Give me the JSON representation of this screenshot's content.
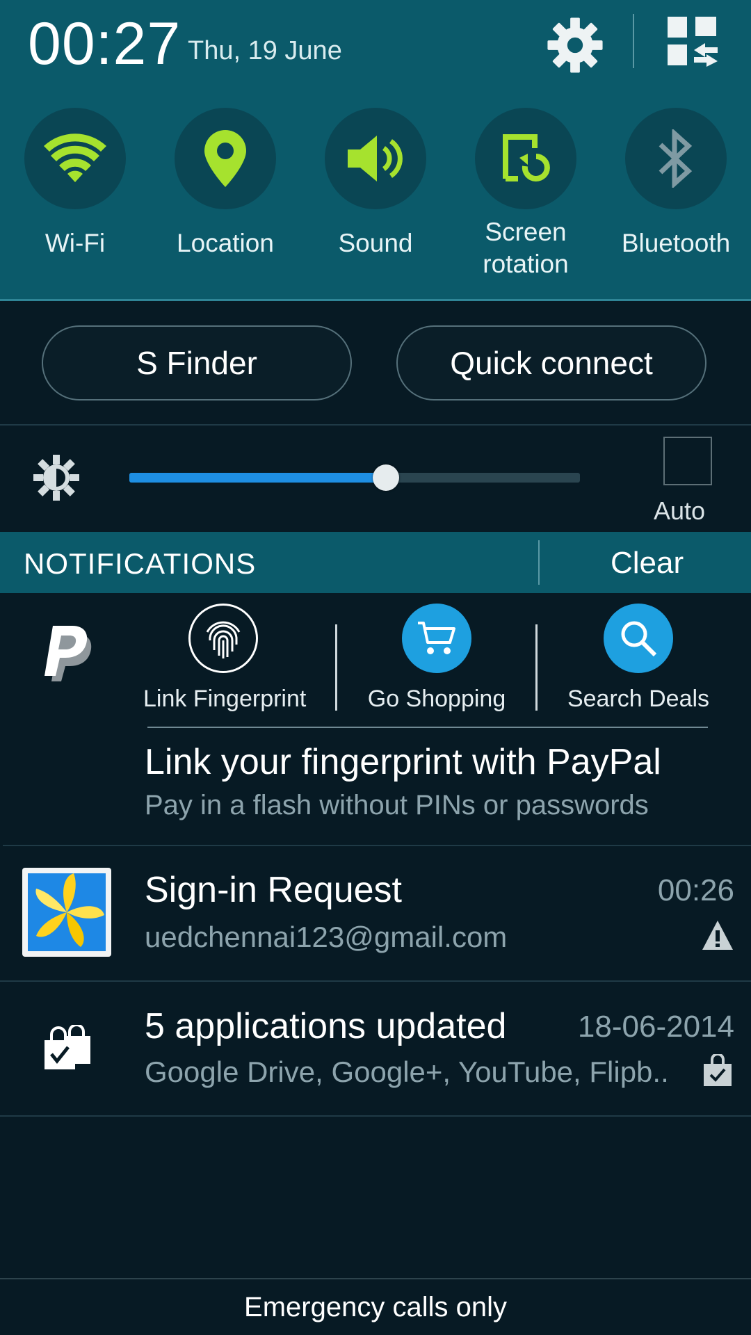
{
  "status": {
    "time": "00:27",
    "date": "Thu, 19 June"
  },
  "toggles": [
    {
      "label": "Wi-Fi",
      "icon": "wifi-icon",
      "active": true
    },
    {
      "label": "Location",
      "icon": "location-pin-icon",
      "active": true
    },
    {
      "label": "Sound",
      "icon": "speaker-icon",
      "active": true
    },
    {
      "label_line1": "Screen",
      "label_line2": "rotation",
      "icon": "screen-rotation-icon",
      "active": true
    },
    {
      "label": "Bluetooth",
      "icon": "bluetooth-icon",
      "active": false
    }
  ],
  "buttons": {
    "s_finder": "S Finder",
    "quick_connect": "Quick connect"
  },
  "brightness": {
    "level": 0.57,
    "auto_label": "Auto",
    "auto_checked": false
  },
  "notifications_header": {
    "title": "NOTIFICATIONS",
    "clear": "Clear"
  },
  "paypal": {
    "logo_text": "PayPal",
    "actions": [
      {
        "label": "Link Fingerprint",
        "icon": "fingerprint-icon"
      },
      {
        "label": "Go Shopping",
        "icon": "shopping-cart-icon"
      },
      {
        "label": "Search Deals",
        "icon": "search-icon"
      }
    ],
    "title": "Link your fingerprint with PayPal",
    "subtitle": "Pay in a flash without PINs or passwords"
  },
  "notifications": [
    {
      "title": "Sign-in Request",
      "subtitle": "uedchennai123@gmail.com",
      "time": "00:26",
      "icon": "samsung-account-icon",
      "badge": "warning-icon"
    },
    {
      "title": "5 applications updated",
      "subtitle": "Google Drive, Google+, YouTube, Flipb..",
      "time": "18-06-2014",
      "icon": "shopping-bag-check-icon",
      "badge": "shopping-bag-check-icon"
    }
  ],
  "footer": "Emergency calls only",
  "colors": {
    "accent_green": "#a6e22e",
    "panel_teal": "#0b5a6a",
    "slider_blue": "#1e8fe3",
    "bg_dark": "#071a24"
  }
}
